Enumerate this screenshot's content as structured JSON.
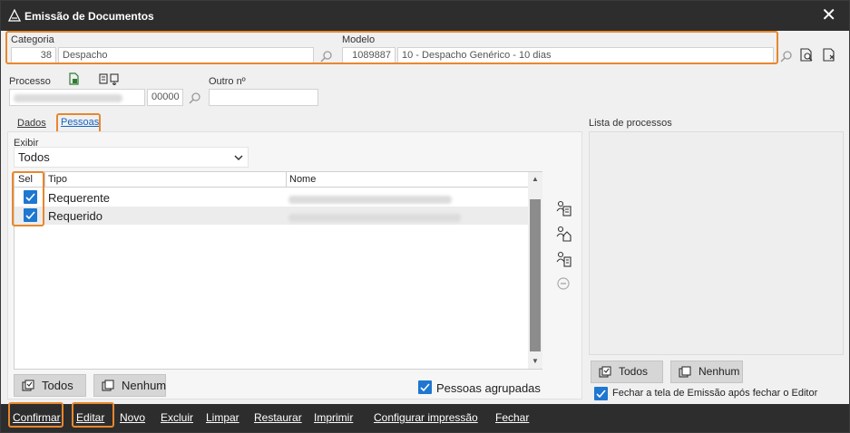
{
  "window": {
    "title": "Emissão de Documentos"
  },
  "header": {
    "categoria": {
      "label": "Categoria",
      "code": "38",
      "value": "Despacho"
    },
    "modelo": {
      "label": "Modelo",
      "code": "1089887",
      "value": "10 - Despacho Genérico - 10 dias"
    }
  },
  "processo": {
    "label": "Processo",
    "suffix": "00000",
    "outro_label": "Outro nº"
  },
  "tabs": [
    {
      "label": "Dados"
    },
    {
      "label": "Pessoas"
    }
  ],
  "pessoas": {
    "exibir_label": "Exibir",
    "exibir_value": "Todos",
    "columns": {
      "sel": "Sel",
      "tipo": "Tipo",
      "nome": "Nome"
    },
    "rows": [
      {
        "tipo": "Requerente",
        "checked": true
      },
      {
        "tipo": "Requerido",
        "checked": true
      }
    ],
    "btn_todos": "Todos",
    "btn_nenhum": "Nenhum",
    "agrupadas_label": "Pessoas agrupadas"
  },
  "lista": {
    "label": "Lista de processos",
    "btn_todos": "Todos",
    "btn_nenhum": "Nenhum",
    "fechar_label": "Fechar a tela de Emissão após fechar o Editor"
  },
  "footer": {
    "confirmar": "Confirmar",
    "editar": "Editar",
    "novo": "Novo",
    "excluir": "Excluir",
    "limpar": "Limpar",
    "restaurar": "Restaurar",
    "imprimir": "Imprimir",
    "configurar": "Configurar impressão",
    "fechar": "Fechar"
  },
  "colors": {
    "accent": "#1e77d0",
    "highlight": "#e8872d",
    "titlebar": "#2d2d2d"
  }
}
